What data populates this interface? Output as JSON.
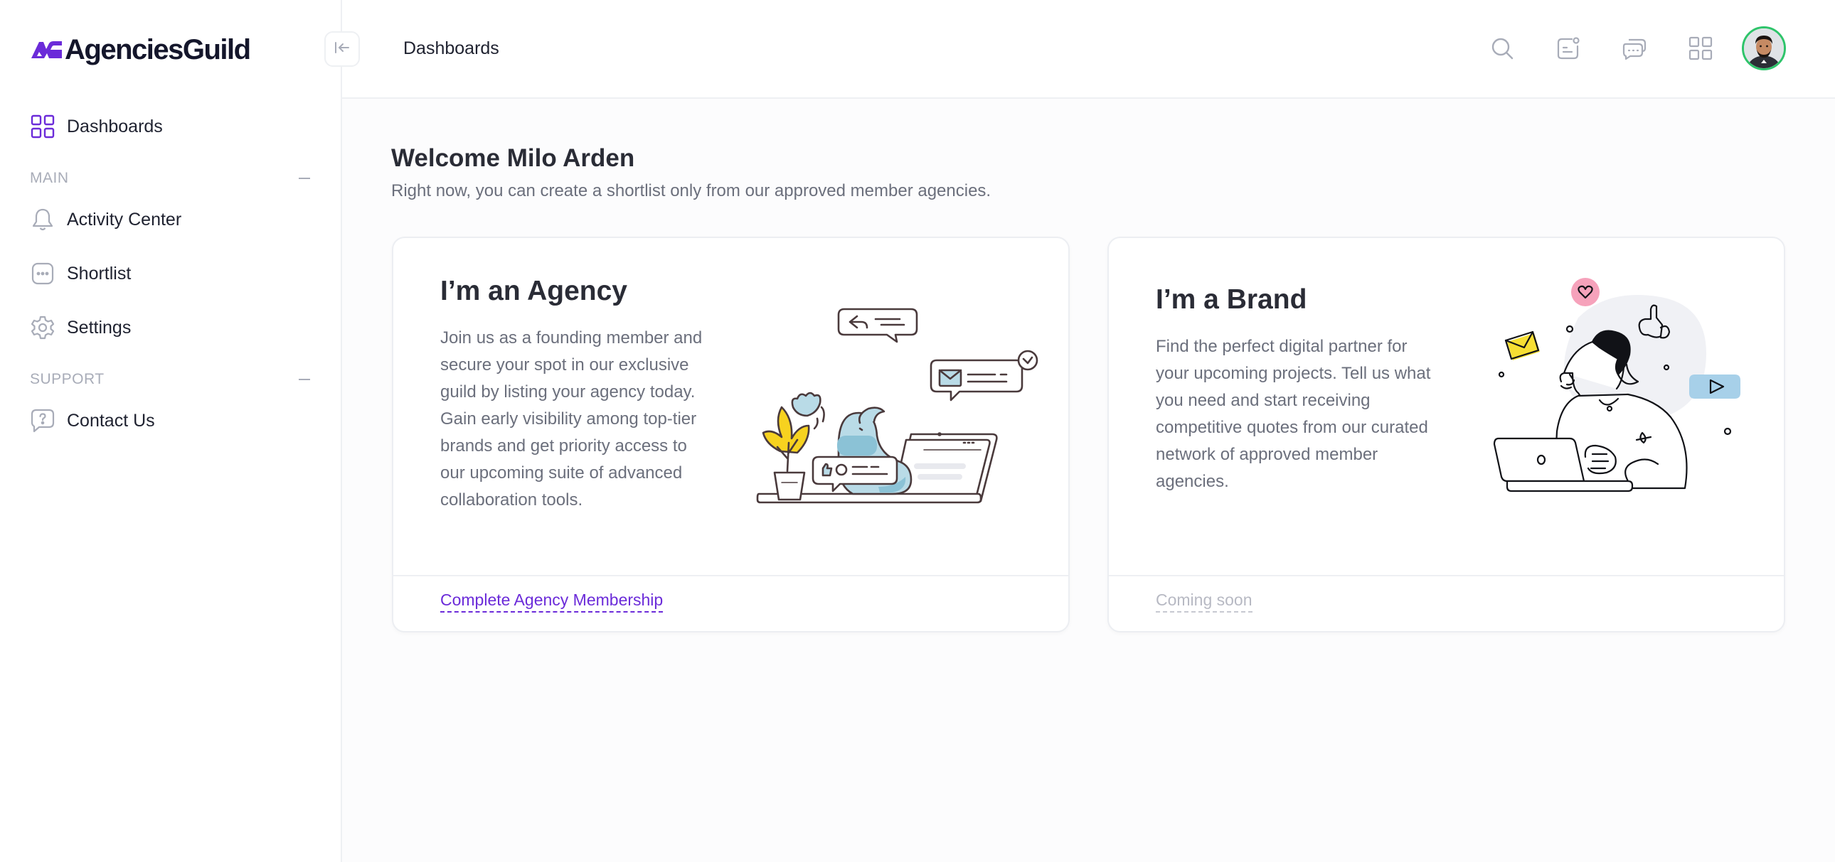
{
  "app": {
    "logo_text": "AgenciesGuild"
  },
  "sidebar": {
    "items": [
      {
        "label": "Dashboards",
        "icon": "grid-icon"
      },
      {
        "label": "Activity Center",
        "icon": "bell-icon"
      },
      {
        "label": "Shortlist",
        "icon": "dots-box-icon"
      },
      {
        "label": "Settings",
        "icon": "gear-icon"
      },
      {
        "label": "Contact Us",
        "icon": "question-chat-icon"
      }
    ],
    "sections": [
      {
        "label": "MAIN"
      },
      {
        "label": "SUPPORT"
      }
    ]
  },
  "header": {
    "title": "Dashboards",
    "icons": [
      "search-icon",
      "notes-icon",
      "chat-icon",
      "apps-grid-icon"
    ]
  },
  "welcome": {
    "title": "Welcome Milo Arden",
    "subtitle": "Right now, you can create a shortlist only from our approved member agencies."
  },
  "cards": [
    {
      "title": "I’m an Agency",
      "text": "Join us as a founding member and secure your spot in our exclusive guild by listing your agency today. Gain early visibility among top-tier brands and get priority access to our upcoming suite of advanced collaboration tools.",
      "link": "Complete Agency Membership"
    },
    {
      "title": "I’m a Brand",
      "text": "Find the perfect digital partner for your upcoming projects. Tell us what you need and start receiving competitive quotes from our curated network of approved member agencies.",
      "link": "Coming soon"
    }
  ],
  "colors": {
    "accent": "#6b2bd9",
    "muted_link": "#b7b9c3",
    "avatar_ring": "#2ec46a"
  }
}
